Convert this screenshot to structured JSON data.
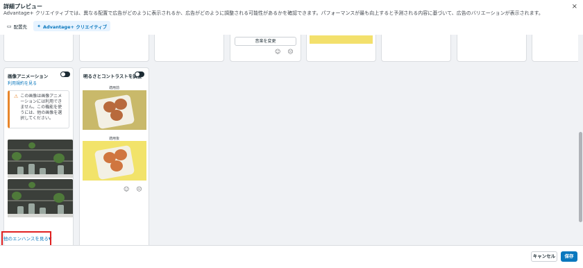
{
  "header": {
    "title": "詳細プレビュー",
    "subtitle": "Advantage+ クリエイティブでは、異なる配置で広告がどのように表示されるか、広告がどのように調整される可能性があるかを確認できます。パフォーマンスが最も向上すると予測される内容に基づいて、広告のバリエーションが表示されます。",
    "close_icon": "×",
    "tabs": [
      {
        "label": "配置先",
        "icon": "placement-icon",
        "active": false
      },
      {
        "label": "Advantage+ クリエイティブ",
        "icon": "sparkle-icon",
        "active": true
      }
    ]
  },
  "top_row": {
    "change_music_label": "音楽を変更"
  },
  "image_animation": {
    "title": "画像アニメーション",
    "terms_link": "利用規約を見る",
    "warning_text": "この画像は画像アニメーションには利用できません。この機能を使うには、他の画像を選択してください。"
  },
  "brightness": {
    "title": "明るさとコントラストを調整",
    "before_label": "適用前",
    "after_label": "適用後"
  },
  "see_more": {
    "label": "他のエンハンスを見る"
  },
  "footer": {
    "cancel_label": "キャンセル",
    "save_label": "保存"
  },
  "colors": {
    "accent": "#0a78be",
    "warning": "#e8852a",
    "highlight_box": "#e02020"
  }
}
